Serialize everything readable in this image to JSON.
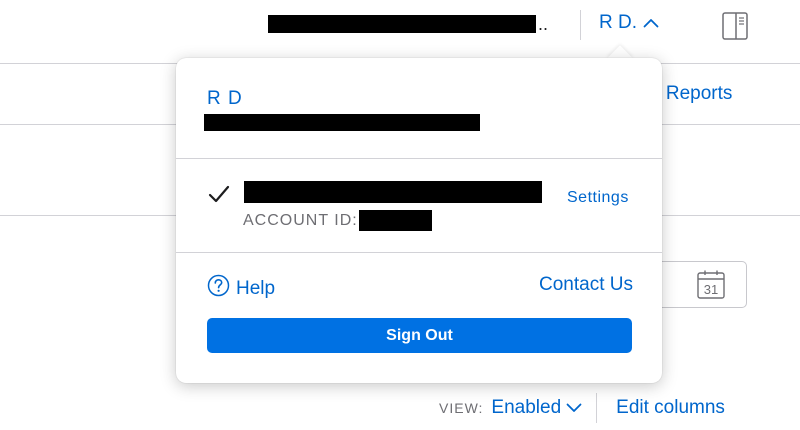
{
  "topbar": {
    "ellipsis": "..",
    "user_label": "R D."
  },
  "background": {
    "reports_label": "n Reports",
    "calendar_day": "31",
    "view_label": "VIEW:",
    "view_value": "Enabled",
    "edit_columns_label": "Edit columns"
  },
  "popover": {
    "user_name": "R D",
    "account_id_label": "ACCOUNT ID:",
    "settings_label": "Settings",
    "help_label": "Help",
    "contact_label": "Contact Us",
    "sign_out_label": "Sign Out"
  },
  "colors": {
    "link": "#0066cc",
    "primary_button": "#0071e3",
    "divider": "#d2d2d7",
    "redaction": "#000000"
  },
  "icons": {
    "user_toggle": "chevron-up-icon",
    "panel": "sidebar-panel-icon",
    "calendar": "calendar-icon",
    "view_dropdown": "chevron-down-icon",
    "selected_account": "checkmark-icon",
    "help": "question-circle-icon"
  }
}
